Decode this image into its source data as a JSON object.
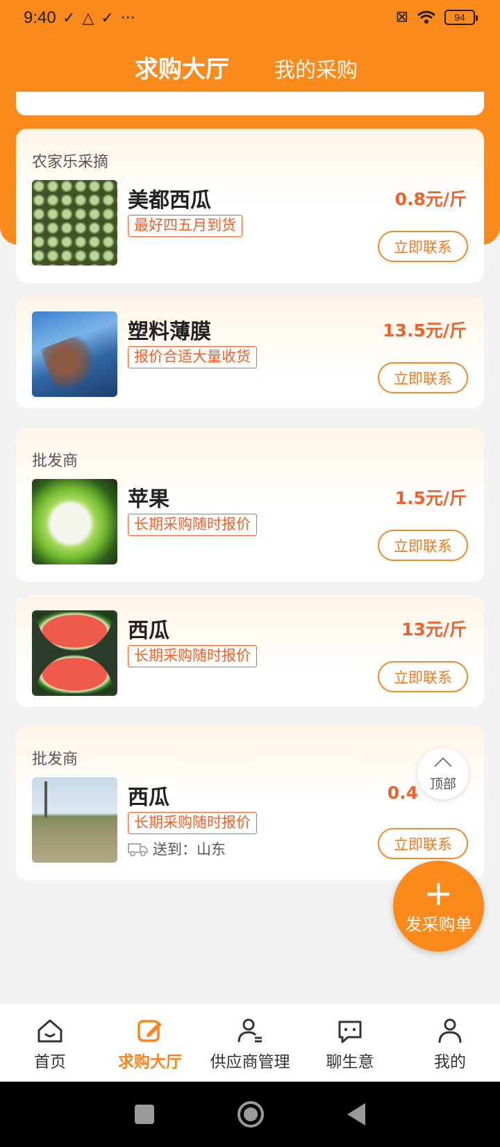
{
  "status_bar": {
    "time": "9:40",
    "battery": "94",
    "icons": [
      "check-icon",
      "warning-icon",
      "check-icon",
      "more-dots-icon",
      "sim-x-icon",
      "wifi-icon",
      "battery-icon"
    ]
  },
  "header": {
    "tabs": [
      {
        "label": "求购大厅",
        "active": true
      },
      {
        "label": "我的采购",
        "active": false
      }
    ]
  },
  "cards": [
    {
      "seller": "农家乐采摘",
      "title": "美都西瓜",
      "tag": "最好四五月到货",
      "price": "0.8元/斤",
      "contact": "立即联系",
      "image": "melon-grid"
    },
    {
      "seller": "",
      "title": "塑料薄膜",
      "tag": "报价合适大量收货",
      "price": "13.5元/斤",
      "contact": "立即联系",
      "image": "plastic-film"
    },
    {
      "seller": "批发商",
      "title": "苹果",
      "tag": "长期采购随时报价",
      "price": "1.5元/斤",
      "contact": "立即联系",
      "image": "apple"
    },
    {
      "seller": "",
      "title": "西瓜",
      "tag": "长期采购随时报价",
      "price": "13元/斤",
      "contact": "立即联系",
      "image": "watermelon"
    },
    {
      "seller": "批发商",
      "title": "西瓜",
      "tag": "长期采购随时报价",
      "price": "0.4",
      "contact": "立即联系",
      "image": "field",
      "delivery": "送到：山东"
    }
  ],
  "float_top": {
    "label": "顶部"
  },
  "fab": {
    "plus": "+",
    "label": "发采购单"
  },
  "bottom_nav": [
    {
      "label": "首页",
      "icon": "home-icon",
      "active": false
    },
    {
      "label": "求购大厅",
      "icon": "edit-icon",
      "active": true
    },
    {
      "label": "供应商管理",
      "icon": "supplier-icon",
      "active": false
    },
    {
      "label": "聊生意",
      "icon": "chat-icon",
      "active": false
    },
    {
      "label": "我的",
      "icon": "profile-icon",
      "active": false
    }
  ],
  "colors": {
    "brand": "#fb8a1c",
    "price": "#f0602b",
    "background": "#f2f2f2"
  }
}
